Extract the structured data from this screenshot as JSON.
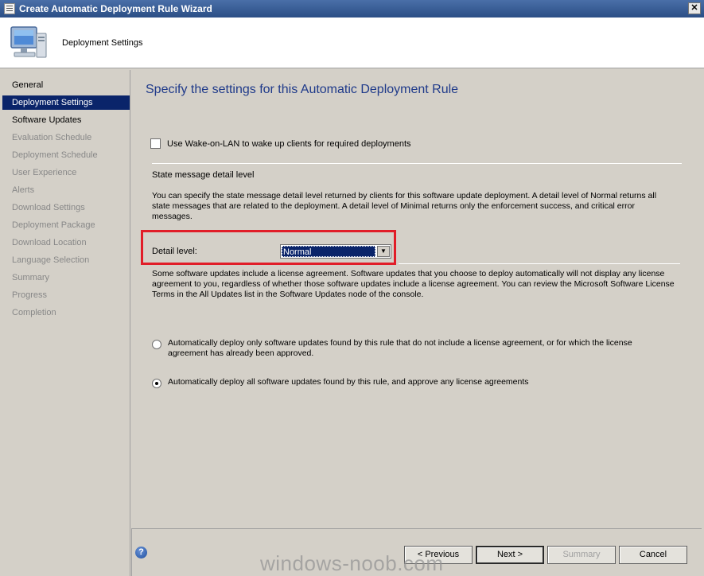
{
  "window": {
    "title": "Create Automatic Deployment Rule Wizard",
    "close_label": "✕"
  },
  "banner": {
    "title": "Deployment Settings",
    "icon": "computer-icon"
  },
  "nav": {
    "items": [
      {
        "label": "General",
        "state": "done"
      },
      {
        "label": "Deployment Settings",
        "state": "active"
      },
      {
        "label": "Software Updates",
        "state": "done"
      },
      {
        "label": "Evaluation Schedule",
        "state": "pending"
      },
      {
        "label": "Deployment Schedule",
        "state": "pending"
      },
      {
        "label": "User Experience",
        "state": "pending"
      },
      {
        "label": "Alerts",
        "state": "pending"
      },
      {
        "label": "Download Settings",
        "state": "pending"
      },
      {
        "label": "Deployment Package",
        "state": "pending"
      },
      {
        "label": "Download Location",
        "state": "pending"
      },
      {
        "label": "Language Selection",
        "state": "pending"
      },
      {
        "label": "Summary",
        "state": "pending"
      },
      {
        "label": "Progress",
        "state": "pending"
      },
      {
        "label": "Completion",
        "state": "pending"
      }
    ]
  },
  "main": {
    "title": "Specify the settings for this Automatic Deployment Rule",
    "wol_checkbox": {
      "label": "Use Wake-on-LAN to wake up clients for required deployments",
      "checked": false
    },
    "state_section_label": "State message detail level",
    "state_description": "You can specify the state message detail level returned by clients for this software update deployment.  A detail level of Normal returns all state messages that are related to the deployment.  A detail level of Minimal returns only the enforcement success, and critical error messages.",
    "detail_level": {
      "label": "Detail level:",
      "value": "Normal"
    },
    "license_description": "Some software updates include a license agreement.  Software updates that you choose to deploy automatically will not display any license agreement to you, regardless of whether those software updates include a license agreement. You can review the Microsoft Software License Terms in the All Updates list in the Software Updates node of the console.",
    "radio_options": [
      {
        "label": "Automatically deploy only software updates found by this rule that do not include a license agreement, or for which the license agreement has already been approved.",
        "checked": false
      },
      {
        "label": "Automatically deploy all software updates found by this rule, and approve any license agreements",
        "checked": true
      }
    ]
  },
  "footer": {
    "help_icon": "help-icon",
    "previous_label": "< Previous",
    "next_label": "Next >",
    "summary_label": "Summary",
    "cancel_label": "Cancel"
  },
  "watermark": "windows-noob.com",
  "colors": {
    "highlight": "#e11d28",
    "selection": "#0a246a",
    "title": "#1f3a8a"
  }
}
